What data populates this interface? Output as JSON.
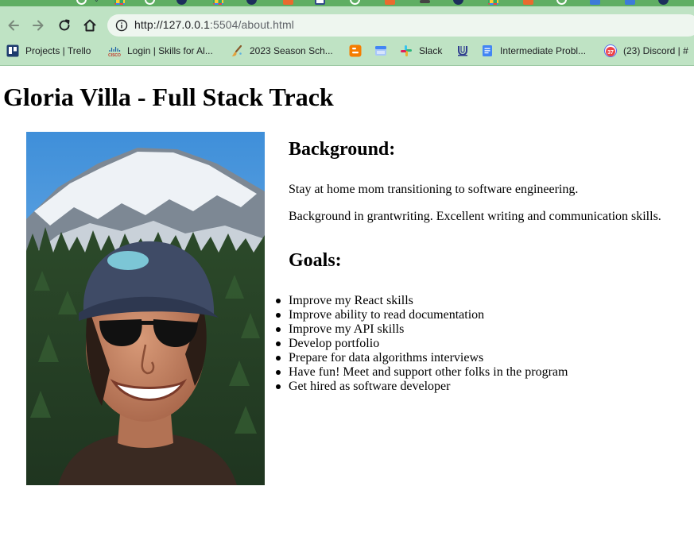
{
  "browser": {
    "url_host": "http://127.0.0.1",
    "url_rest": ":5504/about.html",
    "bookmarks": [
      {
        "label": "Projects | Trello",
        "icon": "trello-icon"
      },
      {
        "label": "Login | Skills for Al...",
        "icon": "cisco-icon"
      },
      {
        "label": "2023 Season Sch...",
        "icon": "paintbrush-icon"
      },
      {
        "label": "",
        "icon": "blogger-icon"
      },
      {
        "label": "",
        "icon": "calendar-icon"
      },
      {
        "label": "Slack",
        "icon": "slack-icon"
      },
      {
        "label": "",
        "icon": "unicorn-icon"
      },
      {
        "label": "Intermediate Probl...",
        "icon": "docs-icon"
      },
      {
        "label": "(23) Discord | #",
        "icon": "discord-icon"
      }
    ],
    "discord_badge": "37"
  },
  "page": {
    "title": "Gloria Villa - Full Stack Track",
    "background_heading": "Background:",
    "background_paragraphs": [
      "Stay at home mom transitioning to software engineering.",
      "Background in grantwriting. Excellent writing and communication skills."
    ],
    "goals_heading": "Goals:",
    "goals": [
      "Improve my React skills",
      "Improve ability to read documentation",
      "Improve my API skills",
      "Develop portfolio",
      "Prepare for data algorithms interviews",
      "Have fun! Meet and support other folks in the program",
      "Get hired as software developer"
    ]
  },
  "colors": {
    "chrome_bg": "#bfe3c4",
    "tabstrip_bg": "#5fae63",
    "url_bg": "#eef6ef"
  }
}
